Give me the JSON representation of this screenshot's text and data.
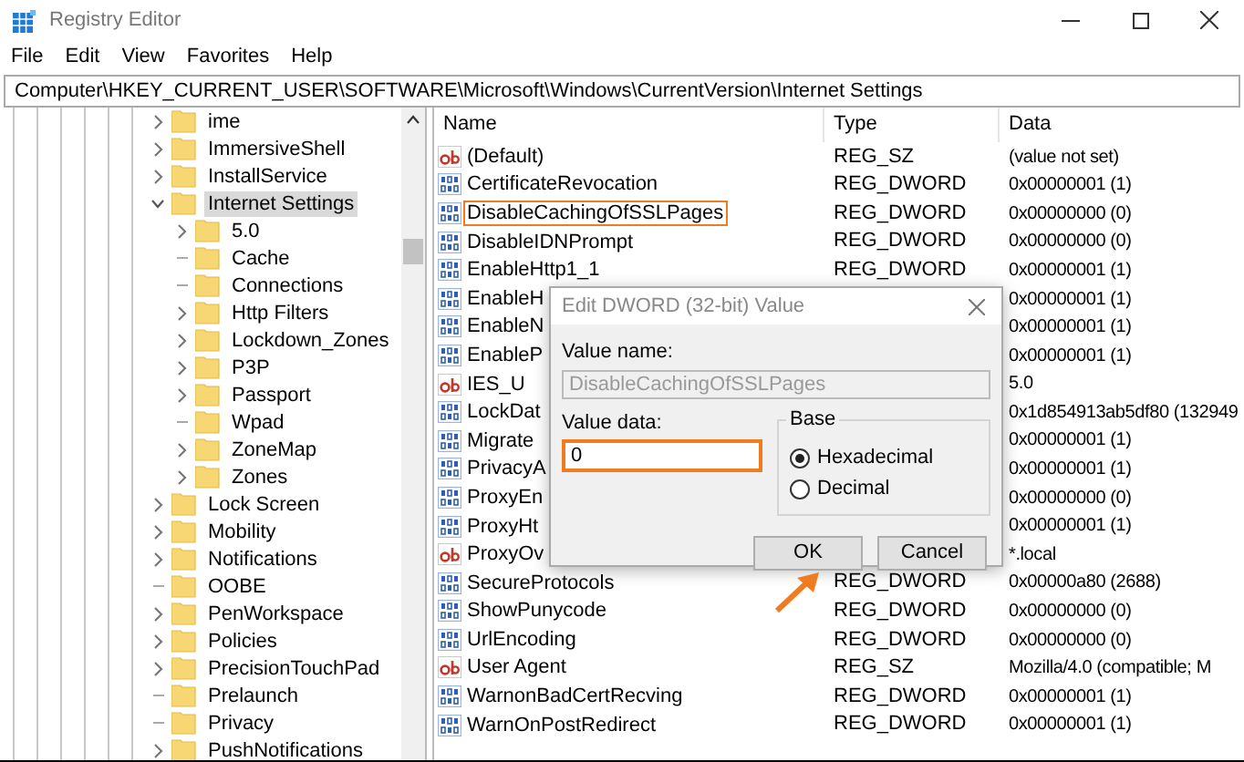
{
  "window": {
    "title": "Registry Editor"
  },
  "menu": [
    "File",
    "Edit",
    "View",
    "Favorites",
    "Help"
  ],
  "address": "Computer\\HKEY_CURRENT_USER\\SOFTWARE\\Microsoft\\Windows\\CurrentVersion\\Internet Settings",
  "tree": [
    {
      "label": "ime",
      "expanded": false,
      "selected": false
    },
    {
      "label": "ImmersiveShell",
      "expanded": false,
      "selected": false
    },
    {
      "label": "InstallService",
      "expanded": false,
      "selected": false
    },
    {
      "label": "Internet Settings",
      "expanded": true,
      "selected": true,
      "children": [
        {
          "label": "5.0",
          "expanded": false,
          "selected": false
        },
        {
          "label": "Cache",
          "selected": false
        },
        {
          "label": "Connections",
          "selected": false
        },
        {
          "label": "Http Filters",
          "expanded": false,
          "selected": false
        },
        {
          "label": "Lockdown_Zones",
          "expanded": false,
          "selected": false
        },
        {
          "label": "P3P",
          "expanded": false,
          "selected": false
        },
        {
          "label": "Passport",
          "expanded": false,
          "selected": false
        },
        {
          "label": "Wpad",
          "selected": false
        },
        {
          "label": "ZoneMap",
          "expanded": false,
          "selected": false
        },
        {
          "label": "Zones",
          "expanded": false,
          "selected": false
        }
      ]
    },
    {
      "label": "Lock Screen",
      "expanded": false,
      "selected": false
    },
    {
      "label": "Mobility",
      "expanded": false,
      "selected": false
    },
    {
      "label": "Notifications",
      "expanded": false,
      "selected": false
    },
    {
      "label": "OOBE",
      "selected": false
    },
    {
      "label": "PenWorkspace",
      "expanded": false,
      "selected": false
    },
    {
      "label": "Policies",
      "expanded": false,
      "selected": false
    },
    {
      "label": "PrecisionTouchPad",
      "expanded": false,
      "selected": false
    },
    {
      "label": "Prelaunch",
      "selected": false
    },
    {
      "label": "Privacy",
      "selected": false
    },
    {
      "label": "PushNotifications",
      "expanded": false,
      "selected": false
    }
  ],
  "table": {
    "columns": [
      "Name",
      "Type",
      "Data"
    ],
    "rows": [
      {
        "kind": "string",
        "name": "(Default)",
        "type": "REG_SZ",
        "data": "(value not set)",
        "highlighted": false
      },
      {
        "kind": "number",
        "name": "CertificateRevocation",
        "type": "REG_DWORD",
        "data": "0x00000001 (1)",
        "highlighted": false
      },
      {
        "kind": "number",
        "name": "DisableCachingOfSSLPages",
        "type": "REG_DWORD",
        "data": "0x00000000 (0)",
        "highlighted": true
      },
      {
        "kind": "number",
        "name": "DisableIDNPrompt",
        "type": "REG_DWORD",
        "data": "0x00000000 (0)",
        "highlighted": false
      },
      {
        "kind": "number",
        "name": "EnableHttp1_1",
        "type": "REG_DWORD",
        "data": "0x00000001 (1)",
        "highlighted": false
      },
      {
        "kind": "number",
        "name": "EnableH",
        "data": "0x00000001 (1)",
        "highlighted": false
      },
      {
        "kind": "number",
        "name": "EnableN",
        "data": "0x00000001 (1)",
        "highlighted": false
      },
      {
        "kind": "number",
        "name": "EnableP",
        "data": "0x00000001 (1)",
        "highlighted": false
      },
      {
        "kind": "string",
        "name": "IES_U",
        "data": "5.0",
        "highlighted": false
      },
      {
        "kind": "number",
        "name": "LockDat",
        "data": "0x1d854913ab5df80 (132949",
        "highlighted": false
      },
      {
        "kind": "number",
        "name": "Migrate",
        "data": "0x00000001 (1)",
        "highlighted": false
      },
      {
        "kind": "number",
        "name": "PrivacyA",
        "data": "0x00000001 (1)",
        "highlighted": false
      },
      {
        "kind": "number",
        "name": "ProxyEn",
        "data": "0x00000000 (0)",
        "highlighted": false
      },
      {
        "kind": "number",
        "name": "ProxyHt",
        "data": "0x00000001 (1)",
        "highlighted": false
      },
      {
        "kind": "string",
        "name": "ProxyOv",
        "data": "*.local",
        "highlighted": false
      },
      {
        "kind": "number",
        "name": "SecureProtocols",
        "type": "REG_DWORD",
        "data": "0x00000a80 (2688)",
        "highlighted": false
      },
      {
        "kind": "number",
        "name": "ShowPunycode",
        "type": "REG_DWORD",
        "data": "0x00000000 (0)",
        "highlighted": false
      },
      {
        "kind": "number",
        "name": "UrlEncoding",
        "type": "REG_DWORD",
        "data": "0x00000000 (0)",
        "highlighted": false
      },
      {
        "kind": "string",
        "name": "User Agent",
        "type": "REG_SZ",
        "data": "Mozilla/4.0 (compatible; M",
        "highlighted": false
      },
      {
        "kind": "number",
        "name": "WarnonBadCertRecving",
        "type": "REG_DWORD",
        "data": "0x00000001 (1)",
        "highlighted": false
      },
      {
        "kind": "number",
        "name": "WarnOnPostRedirect",
        "type": "REG_DWORD",
        "data": "0x00000001 (1)",
        "highlighted": false
      }
    ]
  },
  "dialog": {
    "title": "Edit DWORD (32-bit) Value",
    "value_name_label": "Value name:",
    "value_name": "DisableCachingOfSSLPages",
    "value_data_label": "Value data:",
    "value_data": "0",
    "value_data_highlighted": true,
    "base_label": "Base",
    "base_options": [
      {
        "label": "Hexadecimal",
        "selected": true
      },
      {
        "label": "Decimal",
        "selected": false
      }
    ],
    "buttons": [
      "OK",
      "Cancel"
    ]
  }
}
